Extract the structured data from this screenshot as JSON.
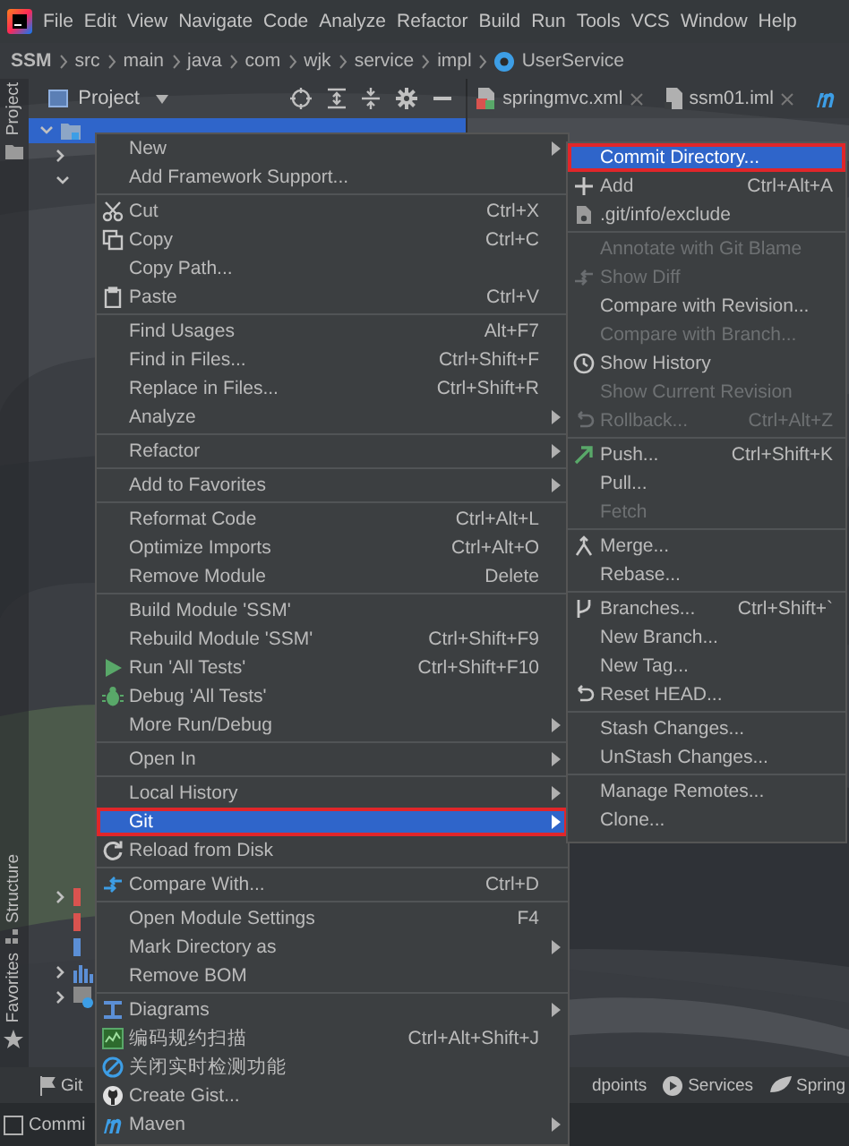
{
  "menubar": {
    "items": [
      "File",
      "Edit",
      "View",
      "Navigate",
      "Code",
      "Analyze",
      "Refactor",
      "Build",
      "Run",
      "Tools",
      "VCS",
      "Window",
      "Help"
    ]
  },
  "breadcrumb": [
    "SSM",
    "src",
    "main",
    "java",
    "com",
    "wjk",
    "service",
    "impl",
    "UserService"
  ],
  "left_stripe": [
    "Project",
    "Structure",
    "Favorites"
  ],
  "project_panel": {
    "title": "Project"
  },
  "editor_tabs": [
    {
      "label": "springmvc.xml",
      "selected": false
    },
    {
      "label": "ssm01.iml",
      "selected": false
    }
  ],
  "bottom_toolbar": {
    "left": [
      "Git"
    ],
    "right": [
      "dpoints",
      "Services",
      "Spring"
    ]
  },
  "bottom_left": "Commi",
  "context_menu": {
    "groups": [
      {
        "items": [
          {
            "label": "New",
            "submenu": true,
            "selected": false,
            "marked": false
          },
          {
            "label": "Add Framework Support...",
            "submenu": false,
            "selected": false,
            "marked": false
          }
        ]
      },
      {
        "items": [
          {
            "label": "Cut",
            "shortcut": "Ctrl+X",
            "submenu": false,
            "selected": false,
            "marked": false
          },
          {
            "label": "Copy",
            "shortcut": "Ctrl+C",
            "submenu": false,
            "selected": false,
            "marked": false
          },
          {
            "label": "Copy Path...",
            "submenu": false,
            "selected": false,
            "marked": false
          },
          {
            "label": "Paste",
            "shortcut": "Ctrl+V",
            "submenu": false,
            "selected": false,
            "marked": false
          }
        ]
      },
      {
        "items": [
          {
            "label": "Find Usages",
            "shortcut": "Alt+F7",
            "submenu": false,
            "selected": false,
            "marked": false
          },
          {
            "label": "Find in Files...",
            "shortcut": "Ctrl+Shift+F",
            "submenu": false,
            "selected": false,
            "marked": false
          },
          {
            "label": "Replace in Files...",
            "shortcut": "Ctrl+Shift+R",
            "submenu": false,
            "selected": false,
            "marked": false
          },
          {
            "label": "Analyze",
            "submenu": true,
            "selected": false,
            "marked": false
          }
        ]
      },
      {
        "items": [
          {
            "label": "Refactor",
            "submenu": true,
            "selected": false,
            "marked": false
          }
        ]
      },
      {
        "items": [
          {
            "label": "Add to Favorites",
            "submenu": true,
            "selected": false,
            "marked": false
          }
        ]
      },
      {
        "items": [
          {
            "label": "Reformat Code",
            "shortcut": "Ctrl+Alt+L",
            "submenu": false,
            "selected": false,
            "marked": false
          },
          {
            "label": "Optimize Imports",
            "shortcut": "Ctrl+Alt+O",
            "submenu": false,
            "selected": false,
            "marked": false
          },
          {
            "label": "Remove Module",
            "shortcut": "Delete",
            "submenu": false,
            "selected": false,
            "marked": false
          }
        ]
      },
      {
        "items": [
          {
            "label": "Build Module 'SSM'",
            "submenu": false,
            "selected": false,
            "marked": false
          },
          {
            "label": "Rebuild Module 'SSM'",
            "shortcut": "Ctrl+Shift+F9",
            "submenu": false,
            "selected": false,
            "marked": false
          },
          {
            "label": "Run 'All Tests'",
            "shortcut": "Ctrl+Shift+F10",
            "submenu": false,
            "selected": false,
            "marked": false
          },
          {
            "label": "Debug 'All Tests'",
            "submenu": false,
            "selected": false,
            "marked": false
          },
          {
            "label": "More Run/Debug",
            "submenu": true,
            "selected": false,
            "marked": false
          }
        ]
      },
      {
        "items": [
          {
            "label": "Open In",
            "submenu": true,
            "selected": false,
            "marked": false
          }
        ]
      },
      {
        "items": [
          {
            "label": "Local History",
            "submenu": true,
            "selected": false,
            "marked": false
          },
          {
            "label": "Git",
            "submenu": true,
            "selected": true,
            "marked": true
          },
          {
            "label": "Reload from Disk",
            "submenu": false,
            "selected": false,
            "marked": false
          }
        ]
      },
      {
        "items": [
          {
            "label": "Compare With...",
            "shortcut": "Ctrl+D",
            "submenu": false,
            "selected": false,
            "marked": false
          }
        ]
      },
      {
        "items": [
          {
            "label": "Open Module Settings",
            "shortcut": "F4",
            "submenu": false,
            "selected": false,
            "marked": false
          },
          {
            "label": "Mark Directory as",
            "submenu": true,
            "selected": false,
            "marked": false
          },
          {
            "label": "Remove BOM",
            "submenu": false,
            "selected": false,
            "marked": false
          }
        ]
      },
      {
        "items": [
          {
            "label": "Diagrams",
            "submenu": true,
            "selected": false,
            "marked": false
          },
          {
            "label": "编码规约扫描",
            "shortcut": "Ctrl+Alt+Shift+J",
            "submenu": false,
            "selected": false,
            "marked": false
          },
          {
            "label": "关闭实时检测功能",
            "submenu": false,
            "selected": false,
            "marked": false
          },
          {
            "label": "Create Gist...",
            "submenu": false,
            "selected": false,
            "marked": false
          },
          {
            "label": "Maven",
            "submenu": true,
            "selected": false,
            "marked": false
          }
        ]
      }
    ]
  },
  "git_submenu": {
    "groups": [
      {
        "items": [
          {
            "label": "Commit Directory...",
            "disabled": false,
            "selected": true,
            "marked": true
          },
          {
            "label": "Add",
            "shortcut": "Ctrl+Alt+A",
            "disabled": false,
            "selected": false,
            "marked": false
          },
          {
            "label": ".git/info/exclude",
            "disabled": false,
            "selected": false,
            "marked": false
          }
        ]
      },
      {
        "items": [
          {
            "label": "Annotate with Git Blame",
            "disabled": true,
            "selected": false,
            "marked": false
          },
          {
            "label": "Show Diff",
            "disabled": true,
            "selected": false,
            "marked": false
          },
          {
            "label": "Compare with Revision...",
            "disabled": false,
            "selected": false,
            "marked": false
          },
          {
            "label": "Compare with Branch...",
            "disabled": true,
            "selected": false,
            "marked": false
          },
          {
            "label": "Show History",
            "disabled": false,
            "selected": false,
            "marked": false
          },
          {
            "label": "Show Current Revision",
            "disabled": true,
            "selected": false,
            "marked": false
          },
          {
            "label": "Rollback...",
            "shortcut": "Ctrl+Alt+Z",
            "disabled": true,
            "selected": false,
            "marked": false
          }
        ]
      },
      {
        "items": [
          {
            "label": "Push...",
            "shortcut": "Ctrl+Shift+K",
            "disabled": false,
            "selected": false,
            "marked": false
          },
          {
            "label": "Pull...",
            "disabled": false,
            "selected": false,
            "marked": false
          },
          {
            "label": "Fetch",
            "disabled": true,
            "selected": false,
            "marked": false
          }
        ]
      },
      {
        "items": [
          {
            "label": "Merge...",
            "disabled": false,
            "selected": false,
            "marked": false
          },
          {
            "label": "Rebase...",
            "disabled": false,
            "selected": false,
            "marked": false
          }
        ]
      },
      {
        "items": [
          {
            "label": "Branches...",
            "shortcut": "Ctrl+Shift+`",
            "disabled": false,
            "selected": false,
            "marked": false
          },
          {
            "label": "New Branch...",
            "disabled": false,
            "selected": false,
            "marked": false
          },
          {
            "label": "New Tag...",
            "disabled": false,
            "selected": false,
            "marked": false
          },
          {
            "label": "Reset HEAD...",
            "disabled": false,
            "selected": false,
            "marked": false
          }
        ]
      },
      {
        "items": [
          {
            "label": "Stash Changes...",
            "disabled": false,
            "selected": false,
            "marked": false
          },
          {
            "label": "UnStash Changes...",
            "disabled": false,
            "selected": false,
            "marked": false
          }
        ]
      },
      {
        "items": [
          {
            "label": "Manage Remotes...",
            "disabled": false,
            "selected": false,
            "marked": false
          },
          {
            "label": "Clone...",
            "disabled": false,
            "selected": false,
            "marked": false
          }
        ]
      }
    ]
  }
}
